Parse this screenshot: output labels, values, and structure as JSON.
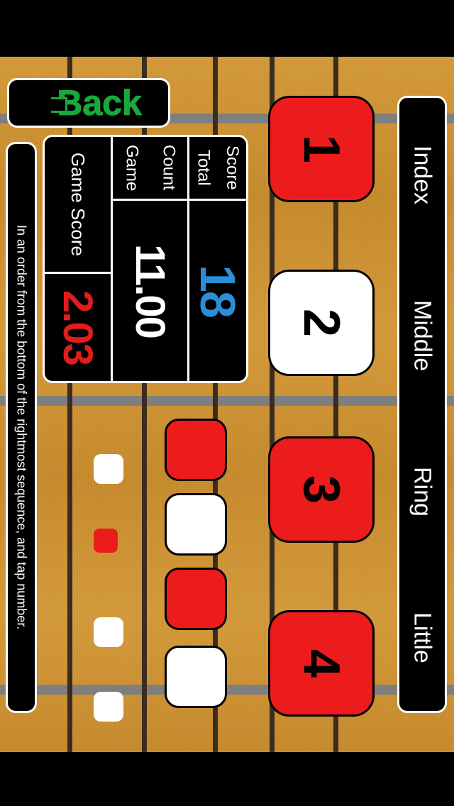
{
  "back_label": "Back",
  "fingers": {
    "f1": "Index",
    "f2": "Middle",
    "f3": "Ring",
    "f4": "Little"
  },
  "big_tiles": {
    "t1": {
      "label": "1",
      "color": "red"
    },
    "t2": {
      "label": "2",
      "color": "white"
    },
    "t3": {
      "label": "3",
      "color": "red"
    },
    "t4": {
      "label": "4",
      "color": "red"
    }
  },
  "score": {
    "total_label_a": "Total",
    "total_label_b": "Score",
    "total_value": "18",
    "count_label_a": "Game",
    "count_label_b": "Count",
    "count_value": "11.00",
    "game_score_label": "Game Score",
    "game_score_value": "2.03"
  },
  "instruction": "In an order from the bottom of the rightmost sequence, and tap number.",
  "sequence_cols": {
    "medium": [
      {
        "color": "red"
      },
      {
        "color": "white"
      },
      {
        "color": "red"
      },
      {
        "color": "white"
      }
    ],
    "small": [
      {
        "color": "white"
      },
      {
        "color": "red"
      },
      {
        "color": "white"
      },
      {
        "color": "white"
      }
    ]
  }
}
